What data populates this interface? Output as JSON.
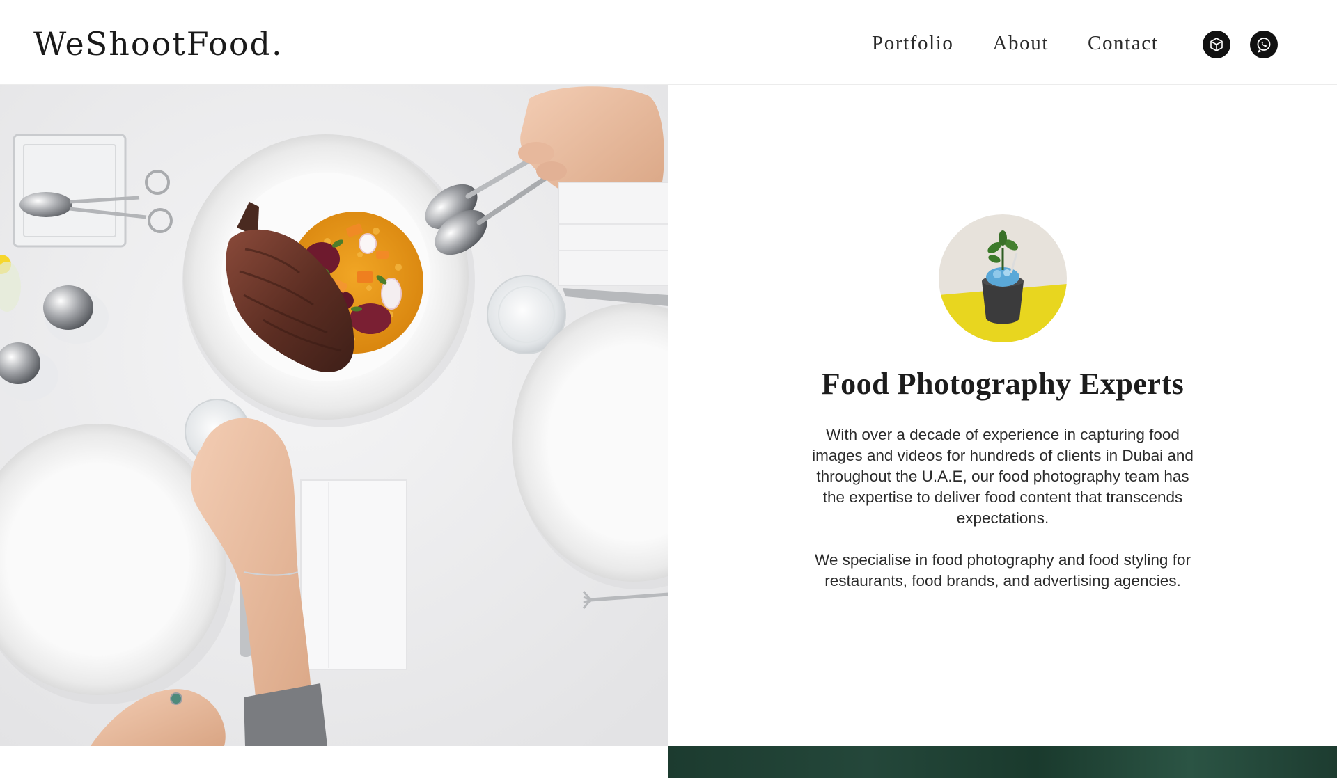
{
  "site": {
    "logo": "WeShootFood."
  },
  "nav": {
    "items": [
      {
        "label": "Portfolio"
      },
      {
        "label": "About"
      },
      {
        "label": "Contact"
      }
    ]
  },
  "social": {
    "items": [
      {
        "icon": "cube-icon"
      },
      {
        "icon": "whatsapp-icon"
      }
    ]
  },
  "intro": {
    "title": "Food Photography Experts",
    "paragraph_1": "With over a decade of experience in capturing food images and videos for hundreds of clients in Dubai and throughout the U.A.E, our food photography team has the expertise to deliver food content that transcends expectations.",
    "paragraph_2": "We specialise in food photography and food styling for restaurants, food brands, and advertising agencies."
  },
  "colors": {
    "accent_dark": "#111111",
    "footer_green": "#1c3b2f",
    "avatar_yellow": "#e8d61f"
  }
}
